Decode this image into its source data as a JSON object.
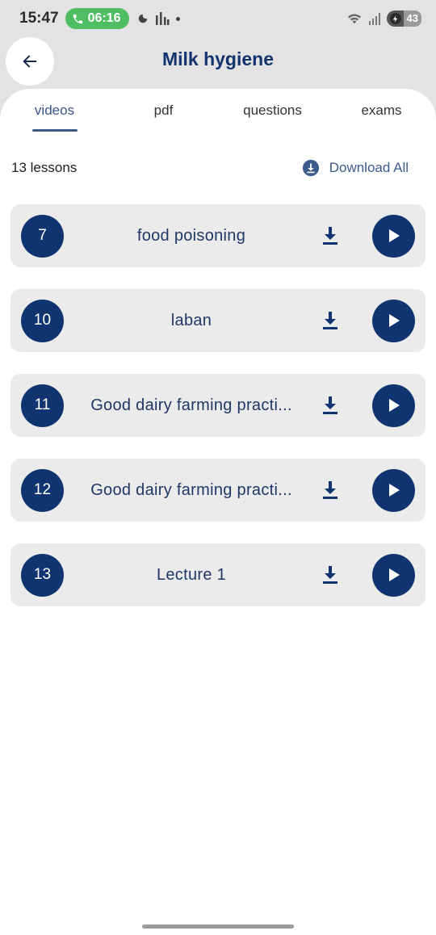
{
  "status_bar": {
    "time": "15:47",
    "call_timer": "06:16",
    "battery": "43"
  },
  "header": {
    "title": "Milk hygiene"
  },
  "tabs": [
    {
      "label": "videos",
      "active": true
    },
    {
      "label": "pdf",
      "active": false
    },
    {
      "label": "questions",
      "active": false
    },
    {
      "label": "exams",
      "active": false
    }
  ],
  "list_header": {
    "lesson_count": "13 lessons",
    "download_all": "Download All"
  },
  "lessons": [
    {
      "number": "7",
      "title": "food poisoning"
    },
    {
      "number": "10",
      "title": "laban"
    },
    {
      "number": "11",
      "title": "Good dairy farming practi..."
    },
    {
      "number": "12",
      "title": "Good dairy farming practi..."
    },
    {
      "number": "13",
      "title": "Lecture 1"
    }
  ],
  "colors": {
    "accent": "#0f3470",
    "call_green": "#4fbe62",
    "card_bg": "#ebebeb"
  }
}
